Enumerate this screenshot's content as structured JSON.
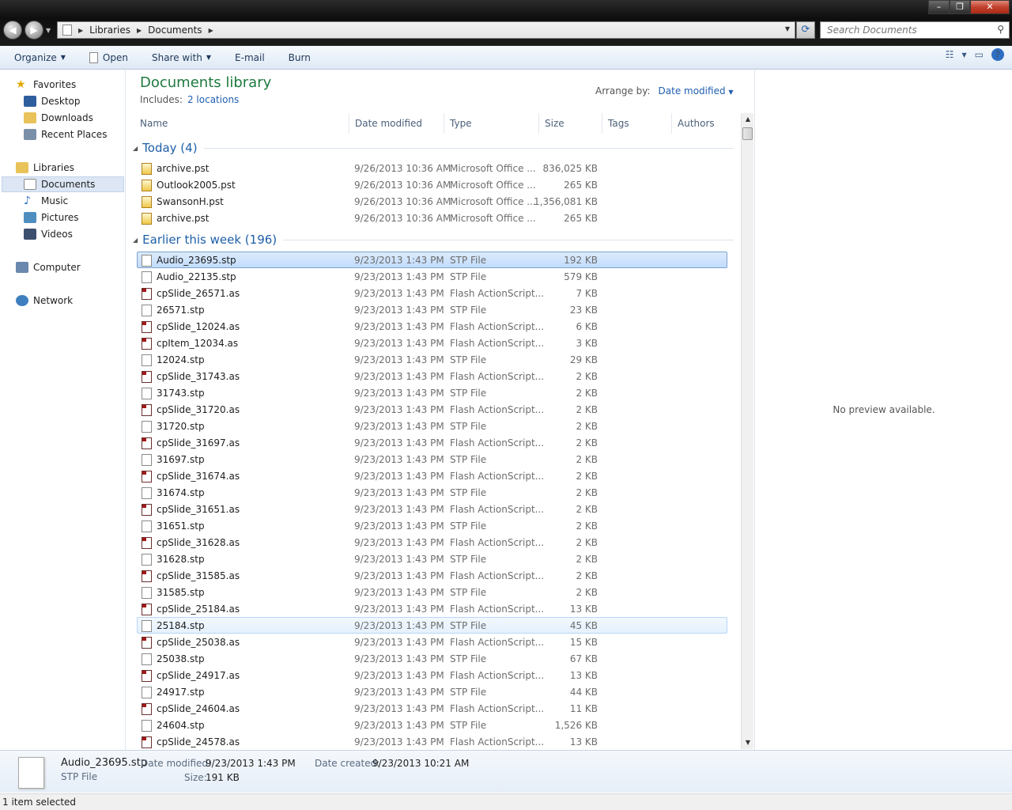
{
  "window": {
    "breadcrumb": [
      "Libraries",
      "Documents"
    ],
    "search_placeholder": "Search Documents"
  },
  "toolbar": {
    "organize": "Organize",
    "open": "Open",
    "share_with": "Share with",
    "email": "E-mail",
    "burn": "Burn"
  },
  "nav": {
    "favorites": "Favorites",
    "desktop": "Desktop",
    "downloads": "Downloads",
    "recent_places": "Recent Places",
    "libraries": "Libraries",
    "documents": "Documents",
    "music": "Music",
    "pictures": "Pictures",
    "videos": "Videos",
    "computer": "Computer",
    "network": "Network"
  },
  "library": {
    "title": "Documents library",
    "includes_label": "Includes:",
    "includes_link": "2 locations",
    "arrange_label": "Arrange by:",
    "arrange_value": "Date modified"
  },
  "columns": {
    "name": "Name",
    "date_modified": "Date modified",
    "type": "Type",
    "size": "Size",
    "tags": "Tags",
    "authors": "Authors"
  },
  "groups": {
    "today": "Today (4)",
    "earlier": "Earlier this week (196)"
  },
  "files_today": [
    {
      "name": "archive.pst",
      "date": "9/26/2013 10:36 AM",
      "type": "Microsoft Office ...",
      "size": "836,025 KB",
      "icon": "pst"
    },
    {
      "name": "Outlook2005.pst",
      "date": "9/26/2013 10:36 AM",
      "type": "Microsoft Office ...",
      "size": "265 KB",
      "icon": "pst"
    },
    {
      "name": "SwansonH.pst",
      "date": "9/26/2013 10:36 AM",
      "type": "Microsoft Office ...",
      "size": "1,356,081 KB",
      "icon": "pst"
    },
    {
      "name": "archive.pst",
      "date": "9/26/2013 10:36 AM",
      "type": "Microsoft Office ...",
      "size": "265 KB",
      "icon": "pst"
    }
  ],
  "files_earlier": [
    {
      "name": "Audio_23695.stp",
      "date": "9/23/2013 1:43 PM",
      "type": "STP File",
      "size": "192 KB",
      "icon": "stp",
      "state": "selected"
    },
    {
      "name": "Audio_22135.stp",
      "date": "9/23/2013 1:43 PM",
      "type": "STP File",
      "size": "579 KB",
      "icon": "stp"
    },
    {
      "name": "cpSlide_26571.as",
      "date": "9/23/2013 1:43 PM",
      "type": "Flash ActionScript...",
      "size": "7 KB",
      "icon": "as"
    },
    {
      "name": "26571.stp",
      "date": "9/23/2013 1:43 PM",
      "type": "STP File",
      "size": "23 KB",
      "icon": "stp"
    },
    {
      "name": "cpSlide_12024.as",
      "date": "9/23/2013 1:43 PM",
      "type": "Flash ActionScript...",
      "size": "6 KB",
      "icon": "as"
    },
    {
      "name": "cpItem_12034.as",
      "date": "9/23/2013 1:43 PM",
      "type": "Flash ActionScript...",
      "size": "3 KB",
      "icon": "as"
    },
    {
      "name": "12024.stp",
      "date": "9/23/2013 1:43 PM",
      "type": "STP File",
      "size": "29 KB",
      "icon": "stp"
    },
    {
      "name": "cpSlide_31743.as",
      "date": "9/23/2013 1:43 PM",
      "type": "Flash ActionScript...",
      "size": "2 KB",
      "icon": "as"
    },
    {
      "name": "31743.stp",
      "date": "9/23/2013 1:43 PM",
      "type": "STP File",
      "size": "2 KB",
      "icon": "stp"
    },
    {
      "name": "cpSlide_31720.as",
      "date": "9/23/2013 1:43 PM",
      "type": "Flash ActionScript...",
      "size": "2 KB",
      "icon": "as"
    },
    {
      "name": "31720.stp",
      "date": "9/23/2013 1:43 PM",
      "type": "STP File",
      "size": "2 KB",
      "icon": "stp"
    },
    {
      "name": "cpSlide_31697.as",
      "date": "9/23/2013 1:43 PM",
      "type": "Flash ActionScript...",
      "size": "2 KB",
      "icon": "as"
    },
    {
      "name": "31697.stp",
      "date": "9/23/2013 1:43 PM",
      "type": "STP File",
      "size": "2 KB",
      "icon": "stp"
    },
    {
      "name": "cpSlide_31674.as",
      "date": "9/23/2013 1:43 PM",
      "type": "Flash ActionScript...",
      "size": "2 KB",
      "icon": "as"
    },
    {
      "name": "31674.stp",
      "date": "9/23/2013 1:43 PM",
      "type": "STP File",
      "size": "2 KB",
      "icon": "stp"
    },
    {
      "name": "cpSlide_31651.as",
      "date": "9/23/2013 1:43 PM",
      "type": "Flash ActionScript...",
      "size": "2 KB",
      "icon": "as"
    },
    {
      "name": "31651.stp",
      "date": "9/23/2013 1:43 PM",
      "type": "STP File",
      "size": "2 KB",
      "icon": "stp"
    },
    {
      "name": "cpSlide_31628.as",
      "date": "9/23/2013 1:43 PM",
      "type": "Flash ActionScript...",
      "size": "2 KB",
      "icon": "as"
    },
    {
      "name": "31628.stp",
      "date": "9/23/2013 1:43 PM",
      "type": "STP File",
      "size": "2 KB",
      "icon": "stp"
    },
    {
      "name": "cpSlide_31585.as",
      "date": "9/23/2013 1:43 PM",
      "type": "Flash ActionScript...",
      "size": "2 KB",
      "icon": "as"
    },
    {
      "name": "31585.stp",
      "date": "9/23/2013 1:43 PM",
      "type": "STP File",
      "size": "2 KB",
      "icon": "stp"
    },
    {
      "name": "cpSlide_25184.as",
      "date": "9/23/2013 1:43 PM",
      "type": "Flash ActionScript...",
      "size": "13 KB",
      "icon": "as"
    },
    {
      "name": "25184.stp",
      "date": "9/23/2013 1:43 PM",
      "type": "STP File",
      "size": "45 KB",
      "icon": "stp",
      "state": "hover"
    },
    {
      "name": "cpSlide_25038.as",
      "date": "9/23/2013 1:43 PM",
      "type": "Flash ActionScript...",
      "size": "15 KB",
      "icon": "as"
    },
    {
      "name": "25038.stp",
      "date": "9/23/2013 1:43 PM",
      "type": "STP File",
      "size": "67 KB",
      "icon": "stp"
    },
    {
      "name": "cpSlide_24917.as",
      "date": "9/23/2013 1:43 PM",
      "type": "Flash ActionScript...",
      "size": "13 KB",
      "icon": "as"
    },
    {
      "name": "24917.stp",
      "date": "9/23/2013 1:43 PM",
      "type": "STP File",
      "size": "44 KB",
      "icon": "stp"
    },
    {
      "name": "cpSlide_24604.as",
      "date": "9/23/2013 1:43 PM",
      "type": "Flash ActionScript...",
      "size": "11 KB",
      "icon": "as"
    },
    {
      "name": "24604.stp",
      "date": "9/23/2013 1:43 PM",
      "type": "STP File",
      "size": "1,526 KB",
      "icon": "stp"
    },
    {
      "name": "cpSlide_24578.as",
      "date": "9/23/2013 1:43 PM",
      "type": "Flash ActionScript...",
      "size": "13 KB",
      "icon": "as"
    }
  ],
  "preview": {
    "text": "No preview available."
  },
  "details": {
    "filename": "Audio_23695.stp",
    "filetype": "STP File",
    "date_modified_label": "Date modified:",
    "date_modified": "9/23/2013 1:43 PM",
    "size_label": "Size:",
    "size": "191 KB",
    "date_created_label": "Date created:",
    "date_created": "9/23/2013 10:21 AM"
  },
  "status": {
    "text": "1 item selected"
  }
}
